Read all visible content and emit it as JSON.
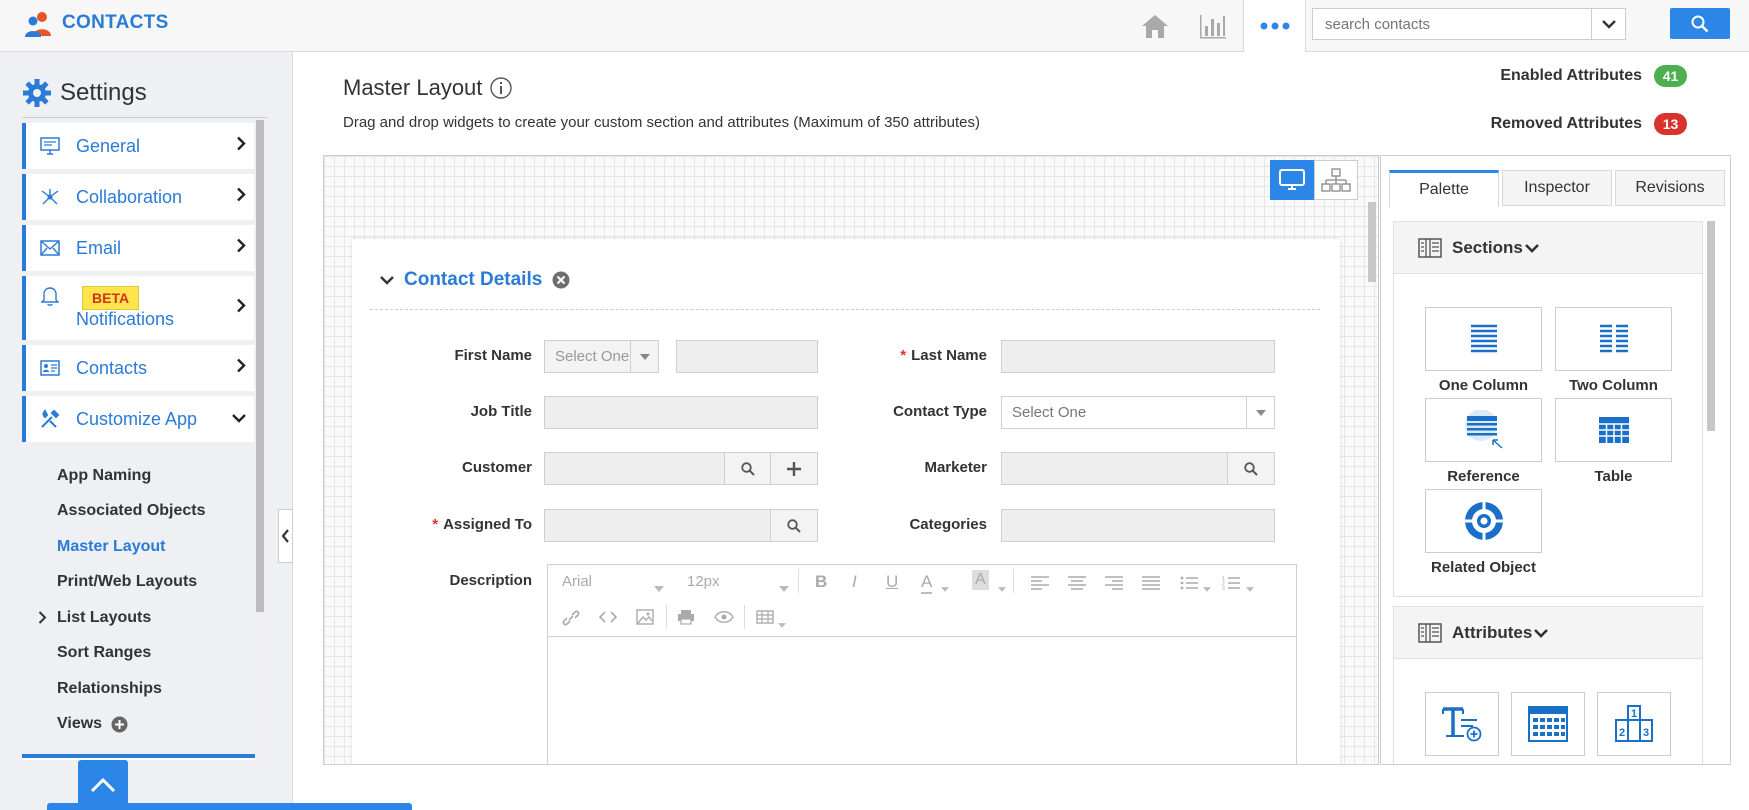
{
  "app": {
    "title": "CONTACTS"
  },
  "header": {
    "search_placeholder": "search contacts",
    "icons": [
      "home-icon",
      "reports-icon",
      "more-icon",
      "chevron-down-icon",
      "search-icon"
    ]
  },
  "sidebar": {
    "title": "Settings",
    "menu": [
      {
        "label": "General",
        "icon": "monitor-icon"
      },
      {
        "label": "Collaboration",
        "icon": "collaboration-icon"
      },
      {
        "label": "Email",
        "icon": "email-icon"
      },
      {
        "label": "Notifications",
        "icon": "bell-icon",
        "badge": "BETA"
      },
      {
        "label": "Contacts",
        "icon": "contacts-icon"
      },
      {
        "label": "Customize App",
        "icon": "tools-icon"
      }
    ],
    "sub_items": [
      "App Naming",
      "Associated Objects",
      "Master Layout",
      "Print/Web Layouts",
      "List Layouts",
      "Sort Ranges",
      "Relationships",
      "Views"
    ],
    "active_sub": "Master Layout"
  },
  "main": {
    "title": "Master Layout",
    "description": "Drag and drop widgets to create your custom section and attributes (Maximum of 350 attributes)",
    "enabled_label": "Enabled Attributes",
    "enabled_count": "41",
    "removed_label": "Removed Attributes",
    "removed_count": "13",
    "colors": {
      "accent": "#2c86e8",
      "enabled": "#4caf50",
      "removed": "#d9342b"
    }
  },
  "form": {
    "section_title": "Contact Details",
    "fields": {
      "first_name": "First Name",
      "last_name": "Last Name",
      "job_title": "Job Title",
      "contact_type": "Contact Type",
      "customer": "Customer",
      "marketer": "Marketer",
      "assigned_to": "Assigned To",
      "categories": "Categories",
      "description": "Description"
    },
    "required_mark": "*",
    "select_one_short": "Select One",
    "select_one": "Select One",
    "editor": {
      "font": "Arial",
      "size": "12px"
    }
  },
  "palette": {
    "tabs": [
      "Palette",
      "Inspector",
      "Revisions"
    ],
    "active_tab": "Palette",
    "sections_title": "Sections",
    "section_widgets": [
      "One Column",
      "Two Column",
      "Reference",
      "Table",
      "Related Object"
    ],
    "attributes_title": "Attributes"
  }
}
